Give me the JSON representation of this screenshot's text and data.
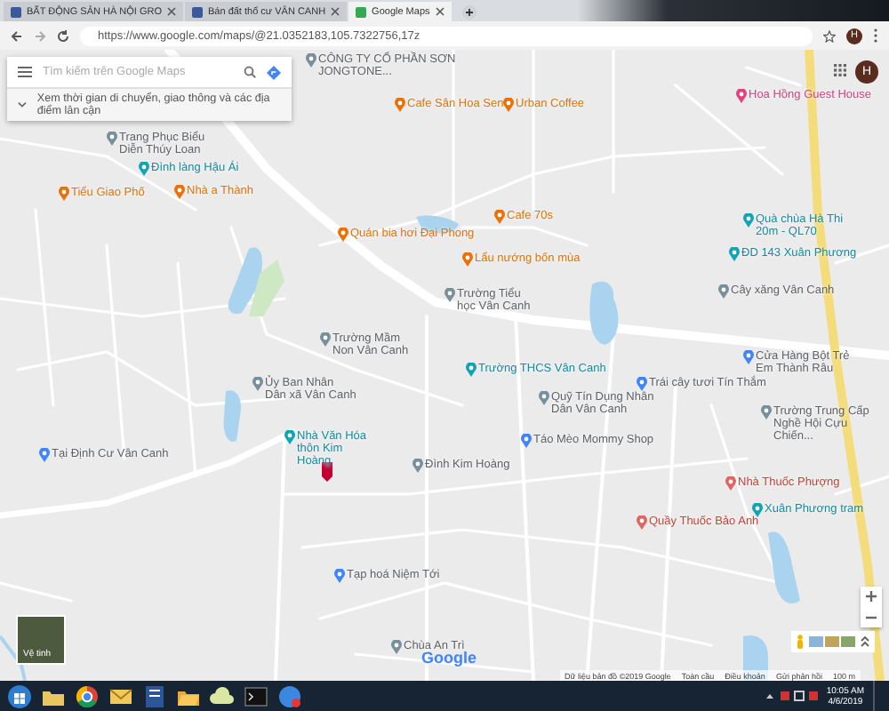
{
  "browser": {
    "tabs": [
      {
        "title": "BẤT ĐỘNG SẢN HÀ NỘI GRO",
        "selected": false
      },
      {
        "title": "Bán đất thổ cư VÂN CANH",
        "selected": false
      },
      {
        "title": "Google Maps",
        "selected": true
      }
    ],
    "address": "https://www.google.com/maps/@21.0352183,105.7322756,17z",
    "profile": "H"
  },
  "search": {
    "placeholder": "Tìm kiếm trên Google Maps",
    "hint": "Xem thời gian di chuyển, giao thông và các địa điểm lân cận"
  },
  "account": "H",
  "places": [
    {
      "name": "CÔNG TY CỔ PHẦN SƠN JONGTONE...",
      "kind": "business"
    },
    {
      "name": "Cafe Sân Hoa Sen",
      "kind": "food"
    },
    {
      "name": "Urban Coffee",
      "kind": "food"
    },
    {
      "name": "Hoa Hồng Guest House",
      "kind": "hotel"
    },
    {
      "name": "Trang Phục Biểu Diễn Thúy Loan",
      "kind": "business"
    },
    {
      "name": "Đình làng Hậu Ái",
      "kind": "landmark"
    },
    {
      "name": "Tiểu Giao Phố",
      "kind": "food"
    },
    {
      "name": "Nhà a Thành",
      "kind": "food"
    },
    {
      "name": "Quán bia hơi Đại Phong",
      "kind": "food"
    },
    {
      "name": "Cafe 70s",
      "kind": "food"
    },
    {
      "name": "Lẩu nướng bốn mùa",
      "kind": "food"
    },
    {
      "name": "Trường Tiểu học Vân Canh",
      "kind": "business"
    },
    {
      "name": "Quà chùa Hà Thi 20m - QL70",
      "kind": "landmark"
    },
    {
      "name": "ĐD 143 Xuân Phương",
      "kind": "landmark"
    },
    {
      "name": "Cây xăng Vân Canh",
      "kind": "business"
    },
    {
      "name": "Trường Mầm Non Vân Canh",
      "kind": "business"
    },
    {
      "name": "Trường THCS Vân Canh",
      "kind": "landmark"
    },
    {
      "name": "Ủy Ban Nhân Dân xã Vân Canh",
      "kind": "business"
    },
    {
      "name": "Cửa Hàng Bột Trẻ Em Thành Râu",
      "kind": "shop"
    },
    {
      "name": "Trái cây tươi Tín Thắm",
      "kind": "shop"
    },
    {
      "name": "Quỹ Tín Dụng Nhân Dân Vân Canh",
      "kind": "business"
    },
    {
      "name": "Táo Mèo Mommy Shop",
      "kind": "shop"
    },
    {
      "name": "Trường Trung Cấp Nghề Hội Cựu Chiến...",
      "kind": "business"
    },
    {
      "name": "Tại Định Cư Vân Canh",
      "kind": "shop"
    },
    {
      "name": "Nhà Văn Hóa thôn Kim Hoàng",
      "kind": "landmark"
    },
    {
      "name": "Đình Kim Hoàng",
      "kind": "business"
    },
    {
      "name": "Nhà Thuốc Phượng",
      "kind": "pharmacy"
    },
    {
      "name": "Xuân Phương tram",
      "kind": "landmark"
    },
    {
      "name": "Quầy Thuốc Bảo Anh",
      "kind": "pharmacy"
    },
    {
      "name": "Tạp hoá Niệm Tới",
      "kind": "shop"
    },
    {
      "name": "Chùa An Trì",
      "kind": "business"
    }
  ],
  "layers": {
    "label": "Vệ tinh"
  },
  "logo": "Google",
  "footer": [
    "Dữ liệu bản đồ ©2019 Google",
    "Toàn cầu",
    "Điều khoản",
    "Gửi phản hồi",
    "100 m"
  ],
  "taskbar": {
    "time": "10:05 AM",
    "date": "4/6/2019"
  }
}
